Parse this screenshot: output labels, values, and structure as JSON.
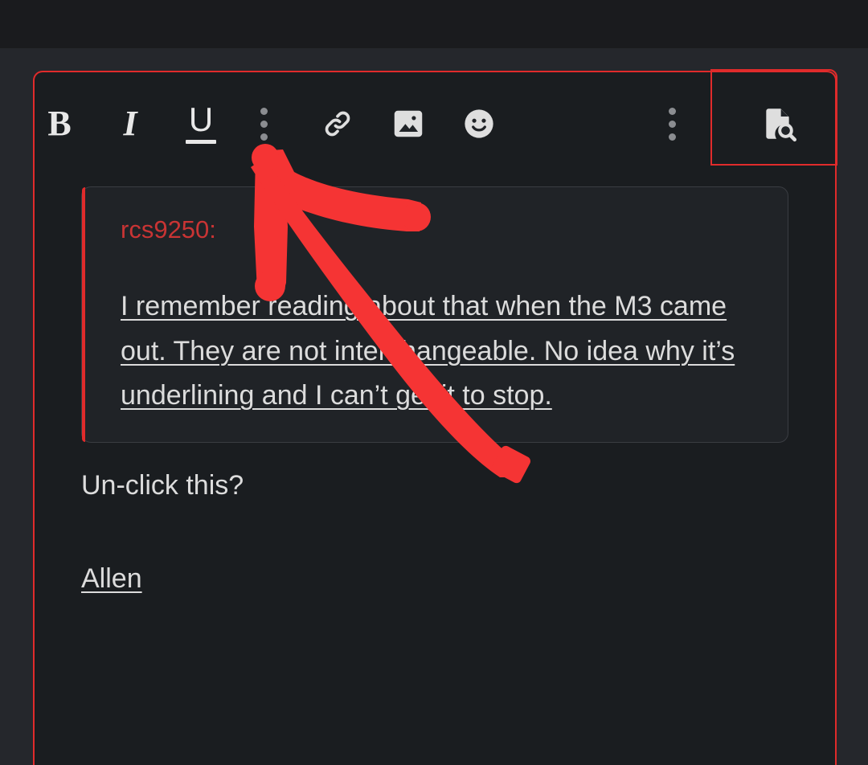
{
  "window": {
    "background_color": "#25272c",
    "topbar_color": "#1a1b1e",
    "editor_background": "#1a1d20"
  },
  "annotation": {
    "color": "#f53434",
    "box_color": "#e02b2b",
    "arrow_label": "red-drawn-arrow-pointing-to-underline-button",
    "highlight_target": "document-search-button",
    "composer_outline_label": "red-box-around-composer"
  },
  "toolbar": {
    "buttons": [
      {
        "name": "bold-button",
        "label": "B",
        "icon": "bold-icon"
      },
      {
        "name": "italic-button",
        "label": "I",
        "icon": "italic-icon"
      },
      {
        "name": "underline-button",
        "label": "U",
        "icon": "underline-icon"
      },
      {
        "name": "more-format-options-button",
        "label": "",
        "icon": "more-vertical-icon"
      },
      {
        "name": "insert-link-button",
        "label": "",
        "icon": "link-icon"
      },
      {
        "name": "insert-image-button",
        "label": "",
        "icon": "image-icon"
      },
      {
        "name": "insert-emoji-button",
        "label": "",
        "icon": "emoji-smiley-icon"
      },
      {
        "name": "more-options-button",
        "label": "",
        "icon": "more-vertical-icon"
      },
      {
        "name": "document-search-button",
        "label": "",
        "icon": "document-search-icon"
      }
    ]
  },
  "editor": {
    "quote": {
      "author": "rcs9250:",
      "author_color": "#c93434",
      "accent_color": "#e02b2b",
      "text": "I remember reading about that when the M3 came out. They are not interchangeable. No idea why it’s underlining and I can’t get it to stop.",
      "underlined": true
    },
    "paragraphs": [
      {
        "text": "Un-click this?",
        "underlined": false
      },
      {
        "text": "Allen",
        "underlined": true
      }
    ]
  }
}
